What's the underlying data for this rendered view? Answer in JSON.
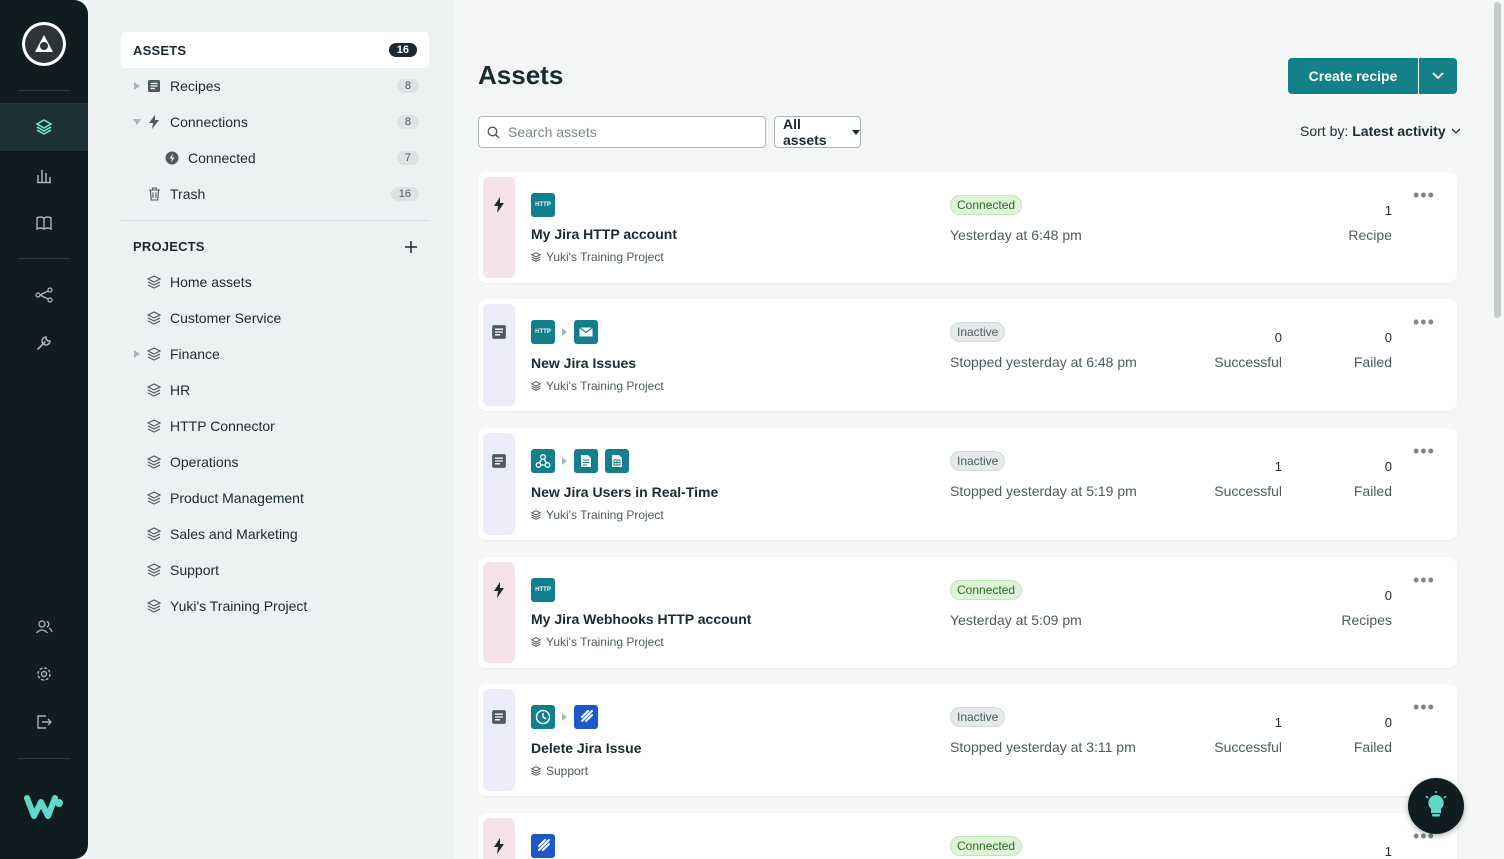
{
  "rail": {
    "items": [
      "assets",
      "dashboard",
      "docs",
      "community",
      "tools",
      "members",
      "settings",
      "sign-out"
    ]
  },
  "sidebar": {
    "assets_header": {
      "title": "ASSETS",
      "count": "16"
    },
    "assets": [
      {
        "label": "Recipes",
        "count": "8"
      },
      {
        "label": "Connections",
        "count": "8"
      },
      {
        "label": "Connected",
        "count": "7"
      },
      {
        "label": "Trash",
        "count": "16"
      }
    ],
    "projects_header": "PROJECTS",
    "projects": [
      "Home assets",
      "Customer Service",
      "Finance",
      "HR",
      "HTTP Connector",
      "Operations",
      "Product Management",
      "Sales and Marketing",
      "Support",
      "Yuki's Training Project"
    ]
  },
  "main": {
    "title": "Assets",
    "create_label": "Create recipe",
    "search_placeholder": "Search assets",
    "filter_label": "All assets",
    "sort_prefix": "Sort by:",
    "sort_value": "Latest activity"
  },
  "cards": [
    {
      "name": "My Jira HTTP account",
      "project": "Yuki's Training Project",
      "status": "Connected",
      "when": "Yesterday at 6:48 pm",
      "stat1_value": "1",
      "stat1_label": "Recipe"
    },
    {
      "name": "New Jira Issues",
      "project": "Yuki's Training Project",
      "status": "Inactive",
      "when": "Stopped yesterday at 6:48 pm",
      "stat1_value": "0",
      "stat1_label": "Successful",
      "stat2_value": "0",
      "stat2_label": "Failed"
    },
    {
      "name": "New Jira Users in Real-Time",
      "project": "Yuki's Training Project",
      "status": "Inactive",
      "when": "Stopped yesterday at 5:19 pm",
      "stat1_value": "1",
      "stat1_label": "Successful",
      "stat2_value": "0",
      "stat2_label": "Failed"
    },
    {
      "name": "My Jira Webhooks HTTP account",
      "project": "Yuki's Training Project",
      "status": "Connected",
      "when": "Yesterday at 5:09 pm",
      "stat1_value": "0",
      "stat1_label": "Recipes"
    },
    {
      "name": "Delete Jira Issue",
      "project": "Support",
      "status": "Inactive",
      "when": "Stopped yesterday at 3:11 pm",
      "stat1_value": "1",
      "stat1_label": "Successful",
      "stat2_value": "0",
      "stat2_label": "Failed"
    },
    {
      "status": "Connected",
      "stat1_value": "1"
    }
  ],
  "app_icon_label": "HTTP"
}
